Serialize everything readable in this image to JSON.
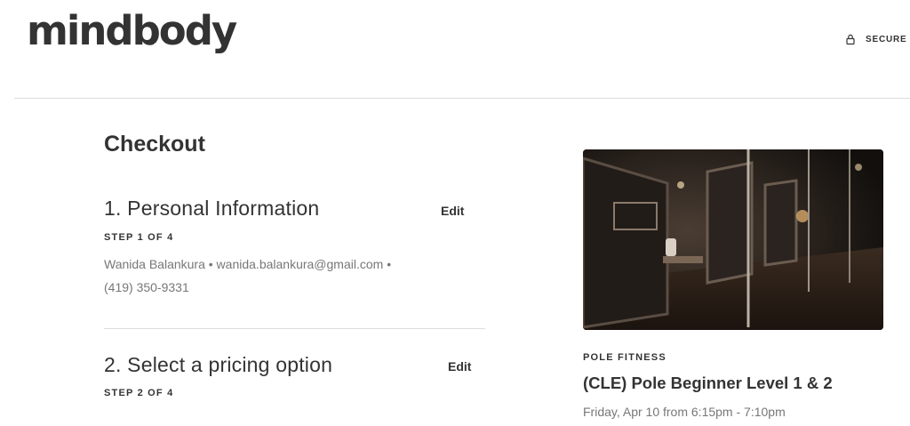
{
  "header": {
    "logo_text": "mindbody",
    "secure_label": "SECURE C"
  },
  "checkout": {
    "title": "Checkout",
    "steps": [
      {
        "title": "1. Personal Information",
        "subtitle": "STEP 1 OF 4",
        "edit_label": "Edit",
        "info_line1": "Wanida Balankura • wanida.balankura@gmail.com •",
        "info_line2": "(419) 350-9331"
      },
      {
        "title": "2. Select a pricing option",
        "subtitle": "STEP 2 OF 4",
        "edit_label": "Edit"
      }
    ]
  },
  "class_summary": {
    "category": "POLE FITNESS",
    "name": "(CLE) Pole Beginner Level 1 & 2",
    "time": "Friday, Apr 10 from 6:15pm - 7:10pm"
  },
  "icons": {
    "secure": "lock-icon"
  },
  "colors": {
    "text_primary": "#333333",
    "text_secondary": "#777777",
    "divider": "#dddddd"
  }
}
